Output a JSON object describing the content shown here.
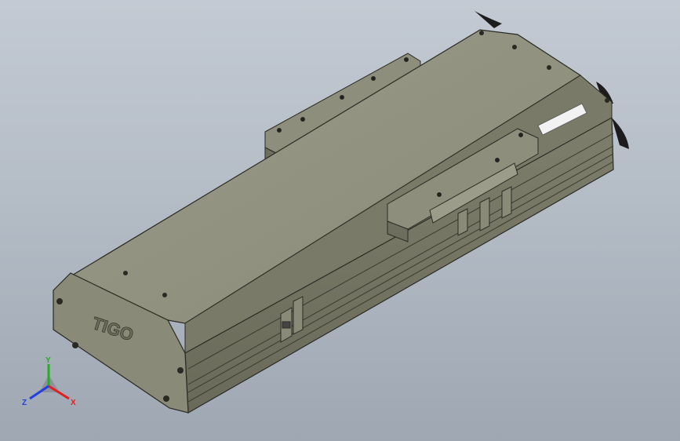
{
  "viewport": {
    "background_top": "#c3cad3",
    "background_bottom": "#9ea7b2"
  },
  "model": {
    "name_plate_text": "TIGO",
    "body_color": "#8e8e7c",
    "edge_color": "#2a2a24"
  },
  "triad": {
    "x_label": "X",
    "y_label": "Y",
    "z_label": "Z",
    "x_color": "#e02020",
    "y_color": "#20b020",
    "z_color": "#2040e0"
  }
}
